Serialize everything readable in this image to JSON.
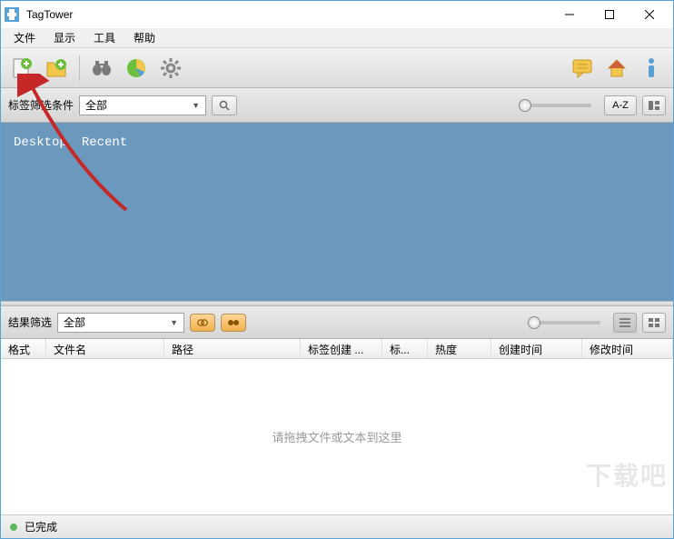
{
  "title": "TagTower",
  "menu": {
    "file": "文件",
    "view": "显示",
    "tools": "工具",
    "help": "帮助"
  },
  "filter": {
    "label": "标签筛选条件",
    "value": "全部",
    "az": "A-Z"
  },
  "tags": {
    "desktop": "Desktop",
    "recent": "Recent"
  },
  "result": {
    "label": "结果筛选",
    "value": "全部"
  },
  "columns": {
    "format": "格式",
    "filename": "文件名",
    "path": "路径",
    "tagcreate": "标签创建 ...",
    "tag": "标...",
    "heat": "热度",
    "ctime": "创建时间",
    "mtime": "修改时间"
  },
  "placeholder": "请拖拽文件或文本到这里",
  "status": "已完成",
  "watermark": "下载吧"
}
